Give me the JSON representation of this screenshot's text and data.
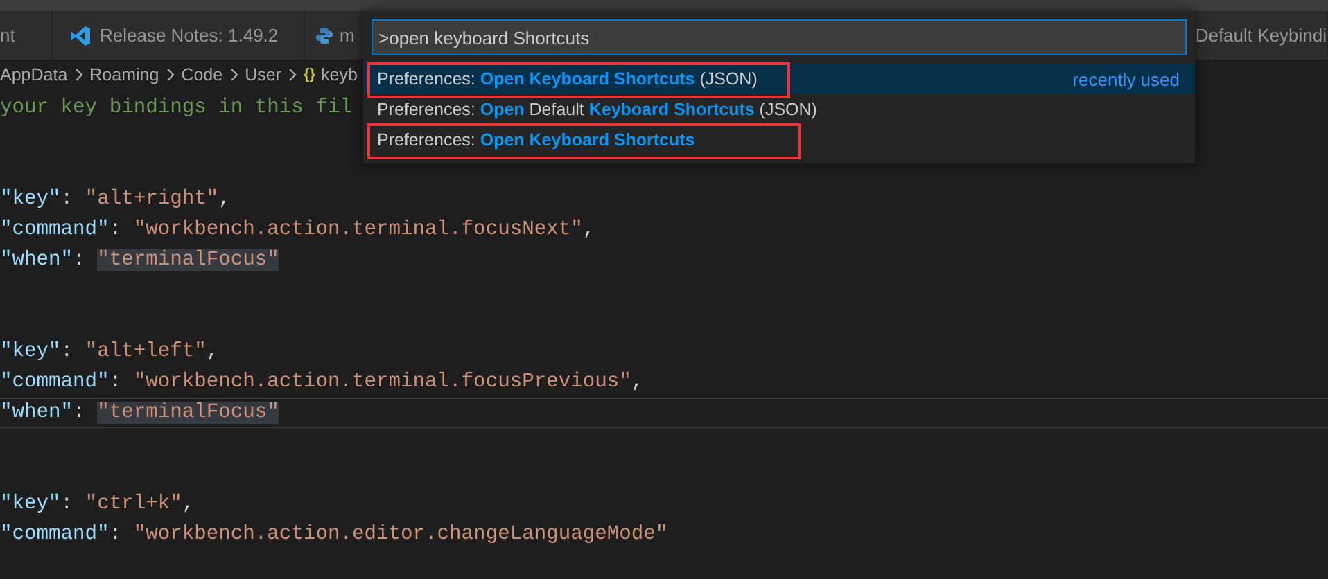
{
  "tabs": [
    {
      "label": "nt",
      "selected": false
    },
    {
      "label": "Release Notes: 1.49.2",
      "selected": false
    },
    {
      "label": "m",
      "selected": false
    },
    {
      "label": "Default Keybindi",
      "selected": false
    }
  ],
  "breadcrumb": {
    "folders": [
      "AppData",
      "Roaming",
      "Code",
      "User"
    ],
    "file_glyph": "{}",
    "file": "keyb"
  },
  "editor": {
    "lines": [
      {
        "kind": "comment",
        "text": "your key bindings in this fil"
      },
      {
        "kind": "blank"
      },
      {
        "kind": "blank"
      },
      {
        "kind": "pair",
        "key": "\"key\"",
        "sep": ": ",
        "value": "\"alt+right\"",
        "tail": ",",
        "highlight": false,
        "current": false
      },
      {
        "kind": "pair",
        "key": "\"command\"",
        "sep": ": ",
        "value": "\"workbench.action.terminal.focusNext\"",
        "tail": ",",
        "highlight": false,
        "current": false
      },
      {
        "kind": "pair",
        "key": "\"when\"",
        "sep": ": ",
        "value": "\"terminalFocus\"",
        "highlight": true,
        "current": false
      },
      {
        "kind": "blank"
      },
      {
        "kind": "blank"
      },
      {
        "kind": "pair",
        "key": "\"key\"",
        "sep": ": ",
        "value": "\"alt+left\"",
        "tail": ",",
        "highlight": false,
        "current": false
      },
      {
        "kind": "pair",
        "key": "\"command\"",
        "sep": ": ",
        "value": "\"workbench.action.terminal.focusPrevious\"",
        "tail": ",",
        "highlight": false,
        "current": false
      },
      {
        "kind": "pair",
        "key": "\"when\"",
        "sep": ": ",
        "value": "\"terminalFocus\"",
        "highlight": true,
        "current": true
      },
      {
        "kind": "blank"
      },
      {
        "kind": "blank"
      },
      {
        "kind": "pair",
        "key": "\"key\"",
        "sep": ": ",
        "value": "\"ctrl+k\"",
        "tail": ",",
        "highlight": false,
        "current": false
      },
      {
        "kind": "pair",
        "key": "\"command\"",
        "sep": ": ",
        "value": "\"workbench.action.editor.changeLanguageMode\"",
        "highlight": false,
        "current": false
      }
    ]
  },
  "command_palette": {
    "input": ">open keyboard Shortcuts",
    "items": [
      {
        "prefix": "Preferences: ",
        "parts": [
          {
            "text": "Open Keyboard Shortcuts",
            "match": true
          },
          {
            "text": " (JSON)",
            "match": false
          }
        ],
        "detail": "recently used",
        "selected": true,
        "highlighted": true
      },
      {
        "prefix": "Preferences: ",
        "parts": [
          {
            "text": "Open",
            "match": true
          },
          {
            "text": " Default ",
            "match": false
          },
          {
            "text": "Keyboard Shortcuts",
            "match": true
          },
          {
            "text": " (JSON)",
            "match": false
          }
        ],
        "selected": false,
        "highlighted": false
      },
      {
        "prefix": "Preferences: ",
        "parts": [
          {
            "text": "Open Keyboard Shortcuts",
            "match": true
          }
        ],
        "selected": false,
        "highlighted": true
      }
    ]
  }
}
